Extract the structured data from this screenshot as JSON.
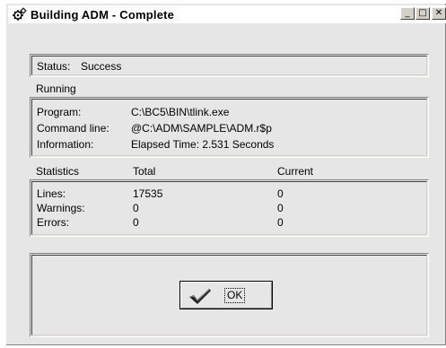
{
  "window": {
    "title": "Building  ADM - Complete",
    "controls": {
      "minimize": "_",
      "maximize": "□",
      "close": "✕"
    }
  },
  "status": {
    "label": "Status:",
    "value": "Success"
  },
  "running": {
    "heading": "Running",
    "rows": [
      {
        "label": "Program:",
        "value": "C:\\BC5\\BIN\\tlink.exe"
      },
      {
        "label": "Command line:",
        "value": "@C:\\ADM\\SAMPLE\\ADM.r$p"
      },
      {
        "label": "Information:",
        "value": "Elapsed Time: 2.531 Seconds"
      }
    ]
  },
  "statistics": {
    "headers": [
      "Statistics",
      "Total",
      "Current"
    ],
    "rows": [
      {
        "label": "Lines:",
        "total": "17535",
        "current": "0"
      },
      {
        "label": "Warnings:",
        "total": "0",
        "current": "0"
      },
      {
        "label": "Errors:",
        "total": "0",
        "current": "0"
      }
    ]
  },
  "ok_button": {
    "label": "OK"
  }
}
